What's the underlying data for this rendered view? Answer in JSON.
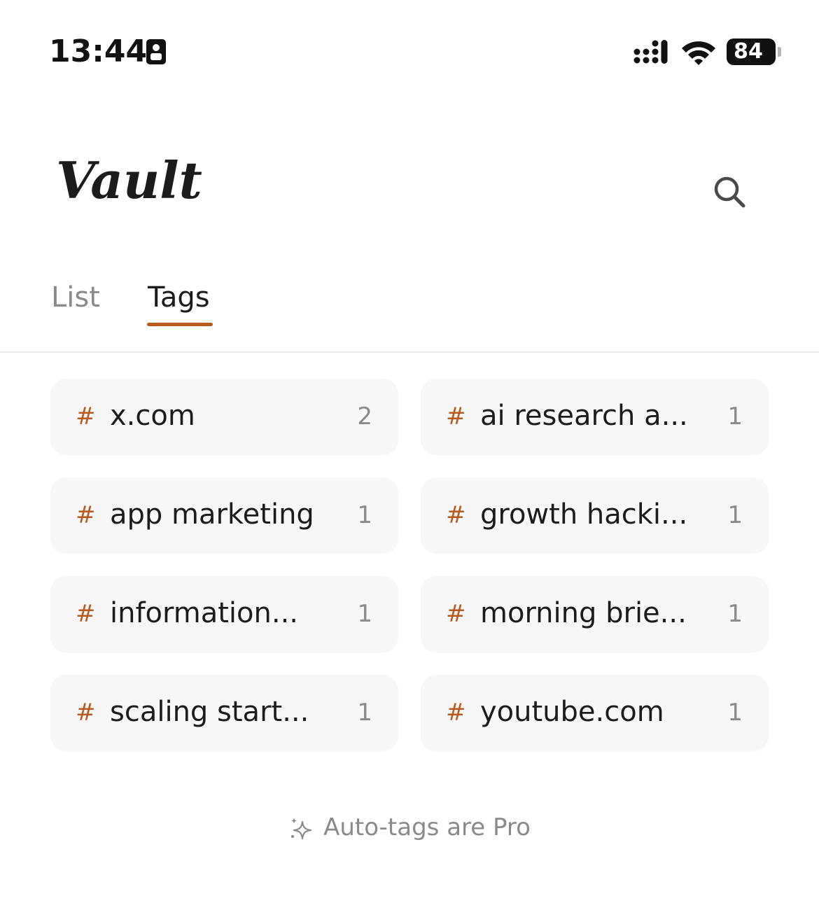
{
  "status_bar": {
    "time": "13:44",
    "battery": "84"
  },
  "header": {
    "title": "Vault"
  },
  "tabs": [
    {
      "label": "List",
      "active": false
    },
    {
      "label": "Tags",
      "active": true
    }
  ],
  "colors": {
    "accent": "#b85a1e",
    "chip_bg": "#f7f7f7",
    "muted_text": "#8a8a8a"
  },
  "tags": [
    {
      "hash": "#",
      "name": "x.com",
      "count": "2"
    },
    {
      "hash": "#",
      "name": "ai research a...",
      "count": "1"
    },
    {
      "hash": "#",
      "name": "app marketing",
      "count": "1"
    },
    {
      "hash": "#",
      "name": "growth hacki...",
      "count": "1"
    },
    {
      "hash": "#",
      "name": "information...",
      "count": "1"
    },
    {
      "hash": "#",
      "name": "morning brie...",
      "count": "1"
    },
    {
      "hash": "#",
      "name": "scaling start...",
      "count": "1"
    },
    {
      "hash": "#",
      "name": "youtube.com",
      "count": "1"
    }
  ],
  "footer": {
    "pro_note": "Auto-tags are Pro"
  },
  "icons": {
    "search": "search-icon",
    "sparkle": "sparkle-icon"
  }
}
